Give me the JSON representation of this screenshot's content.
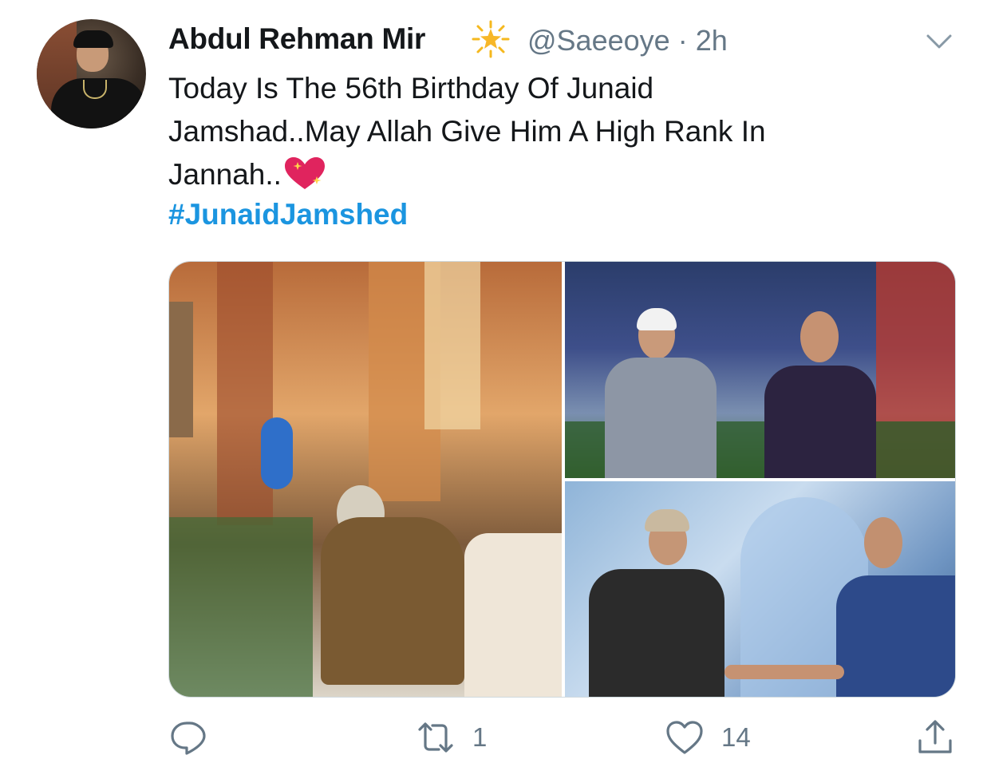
{
  "tweet": {
    "author_name": "Abdul Rehman Mir",
    "handle": "@Saeeoye",
    "separator": "·",
    "time": "2h",
    "text_lines": [
      "Today Is The 56th Birthday Of Junaid",
      "Jamshad..May Allah Give Him A High Rank In",
      "Jannah.."
    ],
    "hashtag": "#JunaidJamshed"
  },
  "actions": {
    "reply_icon": "reply-icon",
    "retweet_icon": "retweet-icon",
    "retweet_count": "1",
    "like_icon": "heart-icon",
    "like_count": "14",
    "share_icon": "share-icon"
  },
  "colors": {
    "text": "#14171a",
    "secondary": "#657786",
    "link": "#1b95e0",
    "border": "#cfd9de"
  }
}
